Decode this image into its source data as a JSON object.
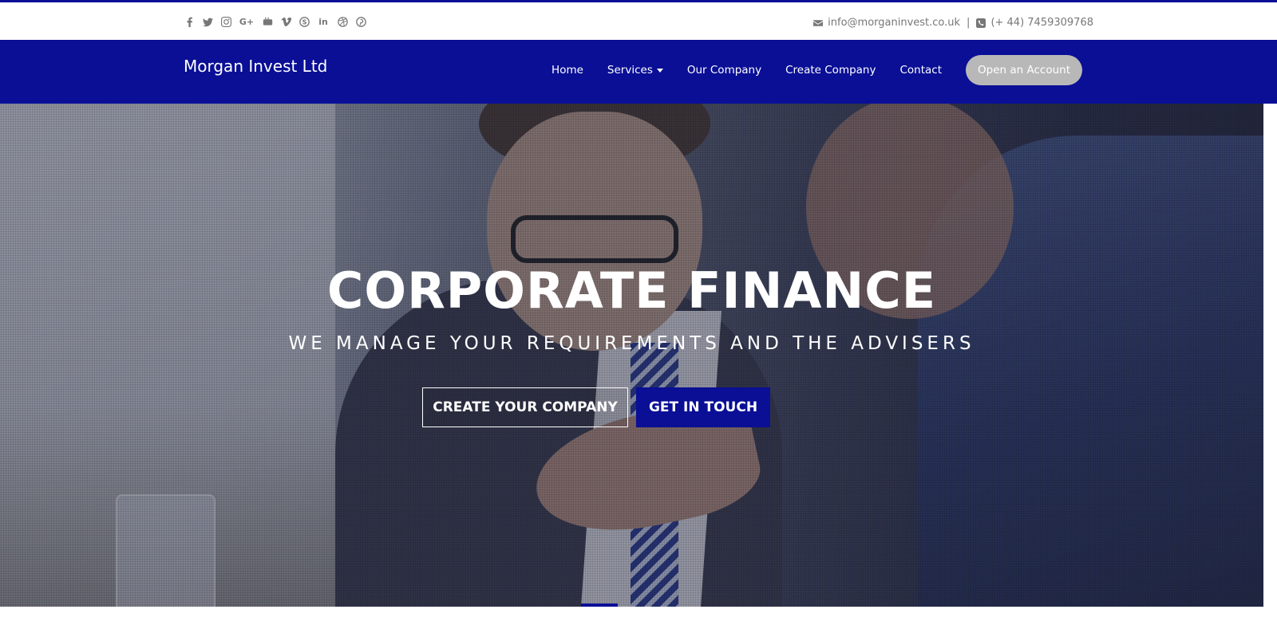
{
  "topbar": {
    "social_icons": [
      "facebook-icon",
      "twitter-icon",
      "instagram-icon",
      "google-plus-icon",
      "youtube-icon",
      "vimeo-icon",
      "skype-icon",
      "linkedin-icon",
      "dribbble-icon",
      "pinterest-icon"
    ],
    "email": "info@morganinvest.co.uk",
    "separator": "|",
    "phone": "(+ 44) 7459309768"
  },
  "navbar": {
    "brand": "Morgan Invest Ltd",
    "items": [
      {
        "label": "Home"
      },
      {
        "label": "Services"
      },
      {
        "label": "Our Company"
      },
      {
        "label": "Create Company"
      },
      {
        "label": "Contact"
      }
    ],
    "account_button": "Open an Account"
  },
  "hero": {
    "title": "CORPORATE FINANCE",
    "subtitle": "WE MANAGE YOUR REQUIREMENTS AND THE ADVISERS",
    "primary_button": "CREATE YOUR COMPANY",
    "secondary_button": "GET IN TOUCH"
  },
  "colors": {
    "brand_blue": "#0a0f96",
    "account_button_bg": "#b8b8b8",
    "muted_text": "#777777"
  }
}
